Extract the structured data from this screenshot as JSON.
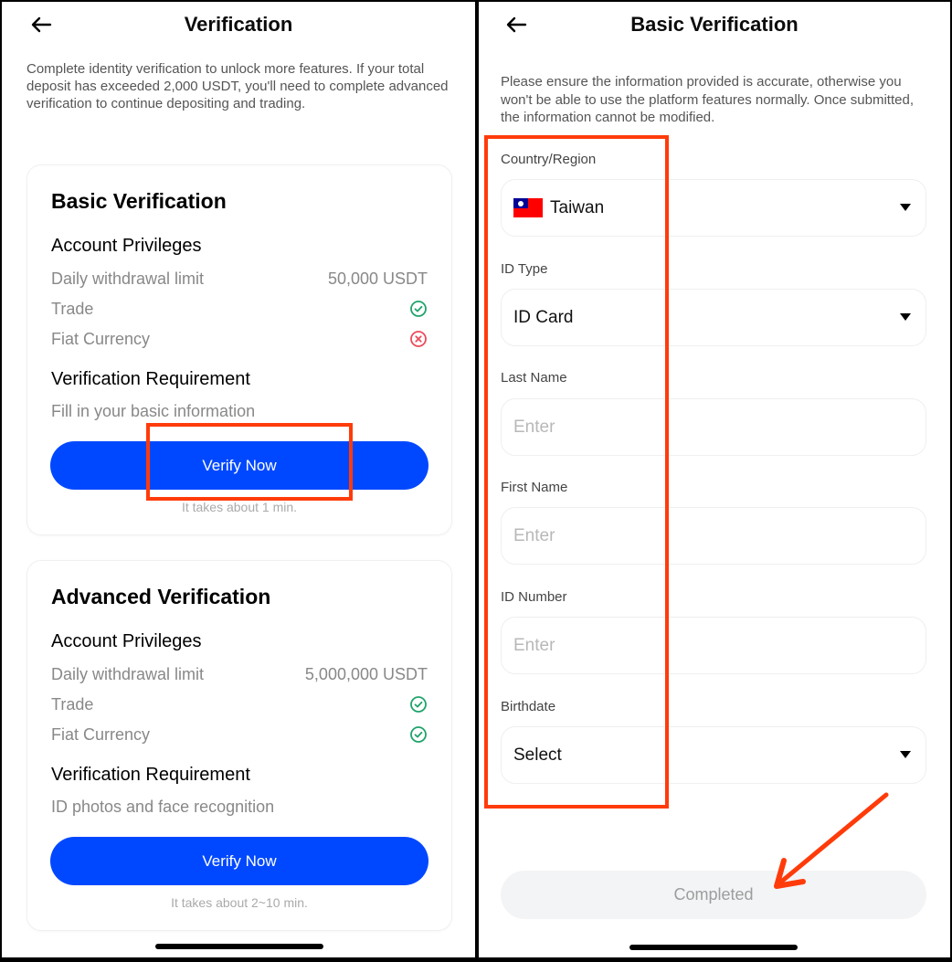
{
  "left": {
    "title": "Verification",
    "intro": "Complete identity verification to unlock more features. If your total deposit has exceeded 2,000 USDT, you'll need to complete advanced verification to continue depositing and trading.",
    "cards": [
      {
        "title": "Basic Verification",
        "privileges_title": "Account Privileges",
        "privileges": [
          {
            "label": "Daily withdrawal limit",
            "value": "50,000 USDT"
          },
          {
            "label": "Trade",
            "status": "check-icon"
          },
          {
            "label": "Fiat Currency",
            "status": "cross-icon"
          }
        ],
        "requirement_title": "Verification Requirement",
        "requirement": "Fill in your basic information",
        "button": "Verify Now",
        "time_note": "It takes about 1 min."
      },
      {
        "title": "Advanced Verification",
        "privileges_title": "Account Privileges",
        "privileges": [
          {
            "label": "Daily withdrawal limit",
            "value": "5,000,000 USDT"
          },
          {
            "label": "Trade",
            "status": "check-icon"
          },
          {
            "label": "Fiat Currency",
            "status": "check-icon"
          }
        ],
        "requirement_title": "Verification Requirement",
        "requirement": "ID photos and face recognition",
        "button": "Verify Now",
        "time_note": "It takes about 2~10 min."
      }
    ]
  },
  "right": {
    "title": "Basic Verification",
    "intro": "Please ensure the information provided is accurate, otherwise you won't be able to use the platform features normally. Once submitted, the information cannot be modified.",
    "fields": [
      {
        "label": "Country/Region",
        "value": "Taiwan",
        "type": "select",
        "icon": "taiwan-flag-icon"
      },
      {
        "label": "ID Type",
        "value": "ID Card",
        "type": "select"
      },
      {
        "label": "Last Name",
        "placeholder": "Enter",
        "type": "input"
      },
      {
        "label": "First Name",
        "placeholder": "Enter",
        "type": "input"
      },
      {
        "label": "ID Number",
        "placeholder": "Enter",
        "type": "input"
      },
      {
        "label": "Birthdate",
        "value": "Select",
        "type": "select"
      }
    ],
    "submit_button": "Completed"
  },
  "colors": {
    "primary": "#0048ff",
    "success": "#1fa36b",
    "error": "#ec4b5b",
    "annotation": "#ff3b0a",
    "disabled_bg": "#f3f4f6",
    "disabled_text": "#9d9d9d"
  }
}
